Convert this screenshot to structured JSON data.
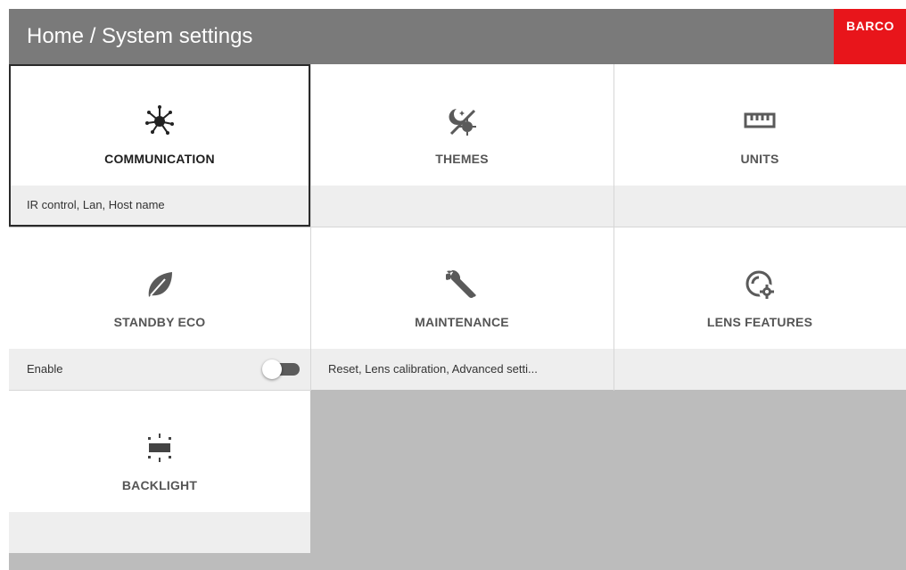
{
  "header": {
    "title": "Home / System settings",
    "logo": "BARCO"
  },
  "colors": {
    "header_bg": "#7a7a7a",
    "logo_bg": "#e8151b",
    "tile_bg": "#ffffff",
    "info_bg": "#eeeeee",
    "empty_bg": "#bcbcbc"
  },
  "tiles": [
    {
      "label": "COMMUNICATION",
      "icon": "network-icon",
      "info": "IR control, Lan, Host name",
      "selected": true
    },
    {
      "label": "THEMES",
      "icon": "theme-icon",
      "info": ""
    },
    {
      "label": "UNITS",
      "icon": "ruler-icon",
      "info": ""
    },
    {
      "label": "STANDBY ECO",
      "icon": "leaf-icon",
      "info": "Enable",
      "toggle": {
        "state": "off"
      }
    },
    {
      "label": "MAINTENANCE",
      "icon": "wrench-icon",
      "info": "Reset, Lens calibration, Advanced setti..."
    },
    {
      "label": "LENS FEATURES",
      "icon": "lens-settings-icon",
      "info": ""
    },
    {
      "label": "BACKLIGHT",
      "icon": "backlight-icon",
      "info": ""
    }
  ]
}
